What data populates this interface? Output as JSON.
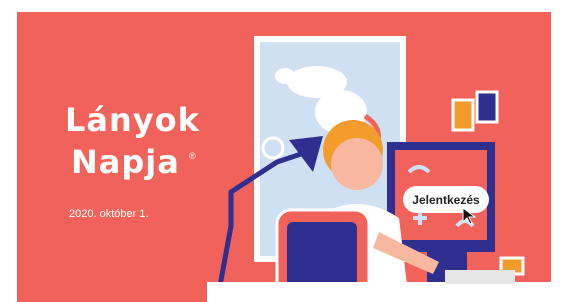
{
  "banner": {
    "logo_line1": "Lányok",
    "logo_line2": "Napja",
    "logo_registered": "®",
    "date": "2020. október 1.",
    "cta_label": "Jelentkezés",
    "colors": {
      "background": "#f0625a",
      "navy": "#2e2f8f",
      "light_blue": "#cfe0f2",
      "white": "#ffffff",
      "orange": "#f39c2c"
    }
  }
}
